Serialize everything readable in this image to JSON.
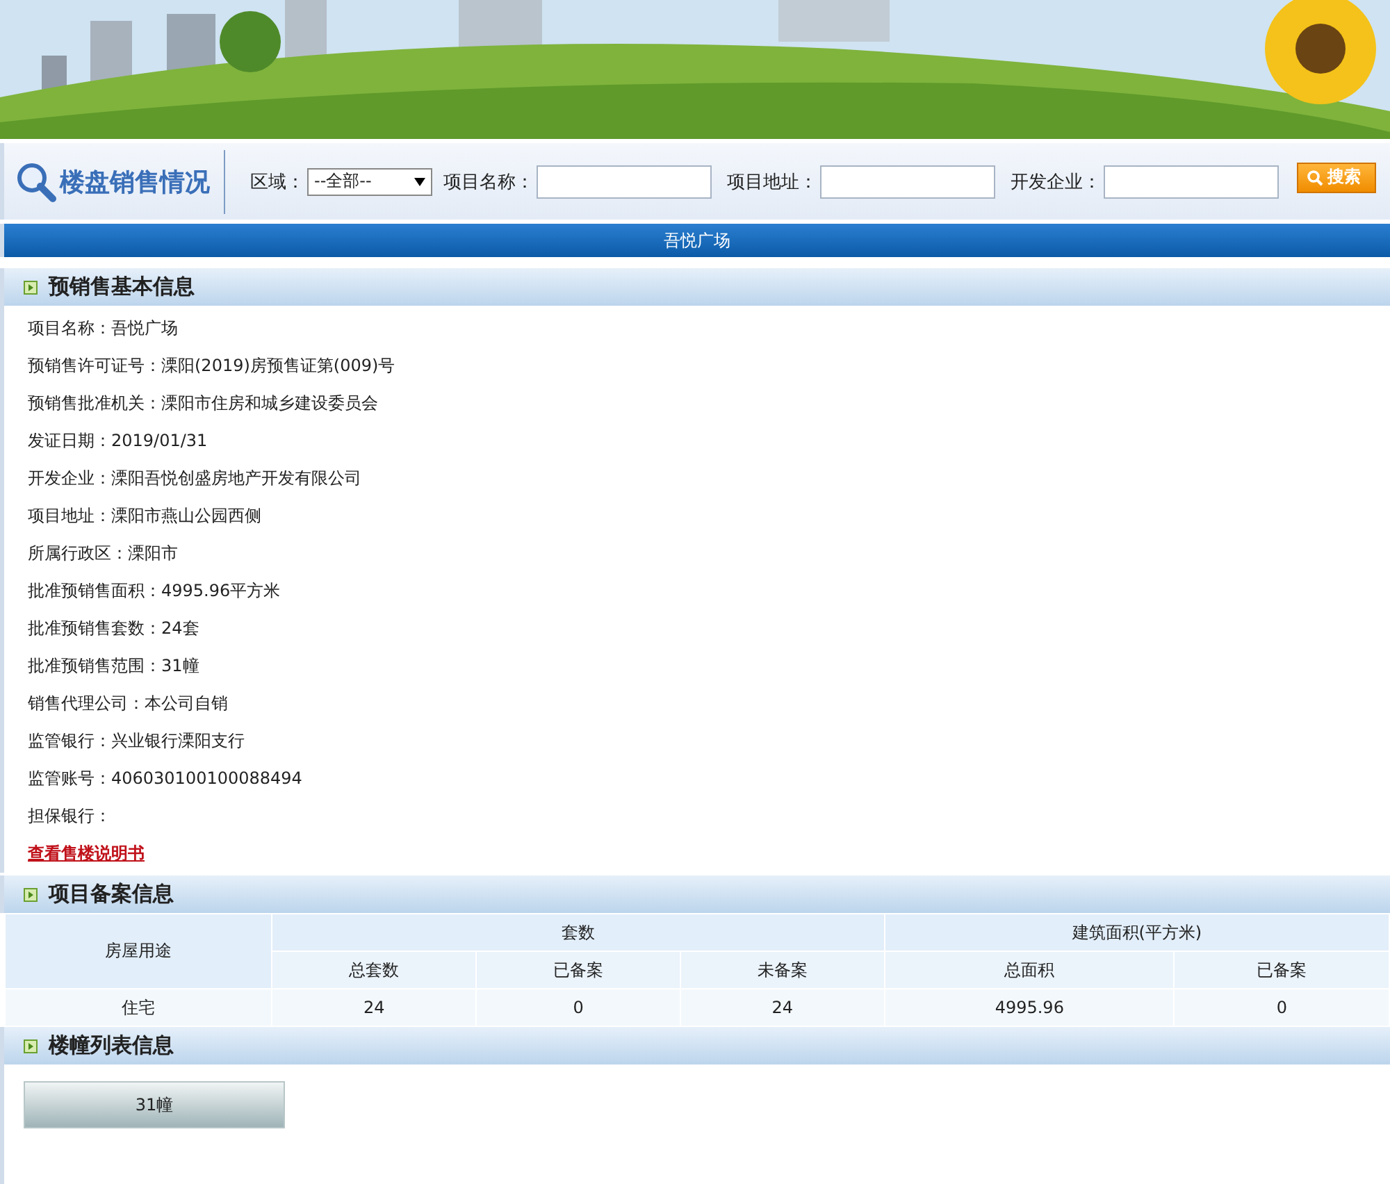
{
  "search": {
    "title": "楼盘销售情况",
    "fields": [
      {
        "kind": "select",
        "label": "区域：",
        "value": "--全部--"
      },
      {
        "kind": "text",
        "label": "项目名称："
      },
      {
        "kind": "text",
        "label": "项目地址："
      },
      {
        "kind": "text",
        "label": "开发企业："
      }
    ],
    "button": "搜索"
  },
  "project_bar": "吾悦广场",
  "basic_info": {
    "title": "预销售基本信息",
    "rows": [
      {
        "label": "项目名称：",
        "value": "吾悦广场"
      },
      {
        "label": "预销售许可证号：",
        "value": "溧阳(2019)房预售证第(009)号"
      },
      {
        "label": "预销售批准机关：",
        "value": "溧阳市住房和城乡建设委员会"
      },
      {
        "label": "发证日期：",
        "value": "2019/01/31"
      },
      {
        "label": "开发企业：",
        "value": "溧阳吾悦创盛房地产开发有限公司"
      },
      {
        "label": "项目地址：",
        "value": "溧阳市燕山公园西侧"
      },
      {
        "label": "所属行政区：",
        "value": "溧阳市"
      },
      {
        "label": "批准预销售面积：",
        "value": "4995.96平方米"
      },
      {
        "label": "批准预销售套数：",
        "value": "24套"
      },
      {
        "label": "批准预销售范围：",
        "value": "31幢"
      },
      {
        "label": "销售代理公司：",
        "value": "本公司自销"
      },
      {
        "label": "监管银行：",
        "value": "兴业银行溧阳支行"
      },
      {
        "label": "监管账号：",
        "value": "406030100100088494"
      },
      {
        "label": "担保银行："
      }
    ],
    "link": "查看售楼说明书"
  },
  "filing": {
    "title": "项目备案信息",
    "table": {
      "usage_header": "房屋用途",
      "groups": [
        {
          "label": "套数",
          "columns": [
            "总套数",
            "已备案",
            "未备案"
          ]
        },
        {
          "label": "建筑面积(平方米)",
          "columns": [
            "总面积",
            "已备案"
          ]
        }
      ],
      "rows": [
        [
          "住宅",
          "24",
          "0",
          "24",
          "4995.96",
          "0"
        ]
      ]
    }
  },
  "buildings": {
    "title": "楼幢列表信息",
    "items": [
      "31幢"
    ]
  }
}
